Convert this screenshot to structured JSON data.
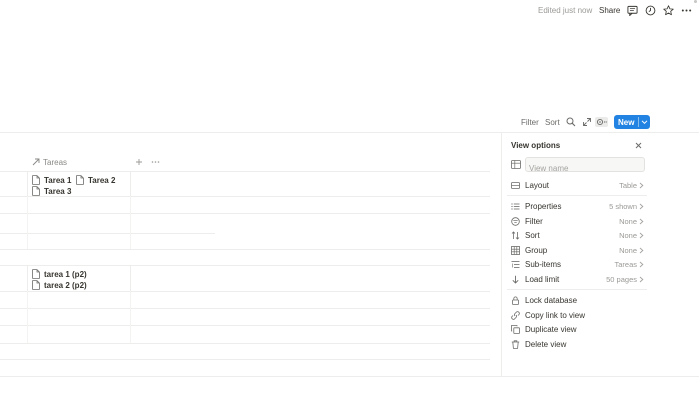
{
  "topbar": {
    "edited": "Edited just now",
    "share": "Share",
    "icons": [
      "comment-icon",
      "clock-icon",
      "star-icon",
      "more-icon"
    ]
  },
  "toolbar": {
    "filter": "Filter",
    "sort": "Sort",
    "new": "New",
    "icons": [
      "search-icon",
      "expand-icon",
      "settings-icon"
    ]
  },
  "table": {
    "column_header": "Tareas",
    "groups": [
      {
        "items": [
          "Tarea 1",
          "Tarea 2",
          "Tarea 3"
        ]
      },
      {
        "items": [
          "tarea 1 (p2)",
          "tarea 2 (p2)"
        ]
      }
    ]
  },
  "view_options": {
    "title": "View options",
    "view_name_placeholder": "View name",
    "layout": {
      "label": "Layout",
      "value": "Table"
    },
    "rows": [
      {
        "label": "Properties",
        "value": "5 shown",
        "icon": "list-icon"
      },
      {
        "label": "Filter",
        "value": "None",
        "icon": "filter-icon"
      },
      {
        "label": "Sort",
        "value": "None",
        "icon": "sort-icon"
      },
      {
        "label": "Group",
        "value": "None",
        "icon": "group-icon"
      },
      {
        "label": "Sub-items",
        "value": "Tareas",
        "icon": "subitems-icon"
      },
      {
        "label": "Load limit",
        "value": "50 pages",
        "icon": "arrow-down-icon"
      }
    ],
    "actions": [
      {
        "label": "Lock database",
        "icon": "lock-icon"
      },
      {
        "label": "Copy link to view",
        "icon": "link-icon"
      },
      {
        "label": "Duplicate view",
        "icon": "duplicate-icon"
      },
      {
        "label": "Delete view",
        "icon": "trash-icon"
      }
    ]
  },
  "colors": {
    "accent": "#2383e2",
    "text": "#37352f",
    "muted": "#9b9a97",
    "divider": "#ededeb"
  }
}
